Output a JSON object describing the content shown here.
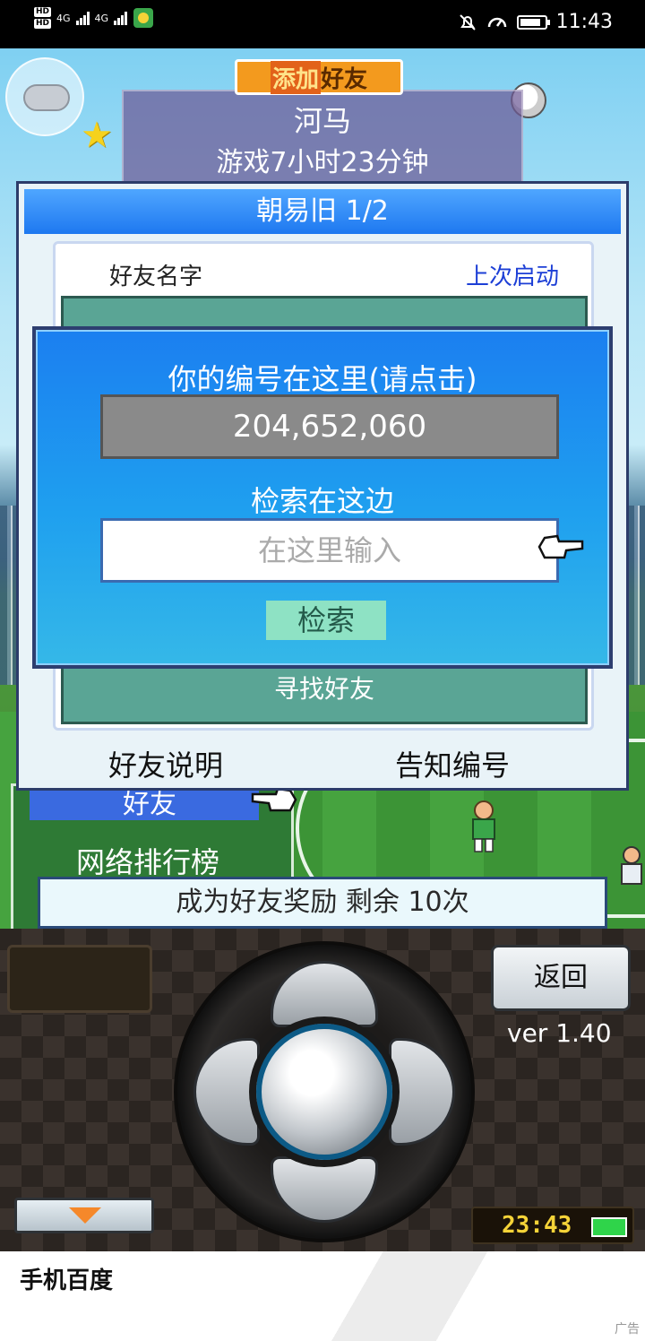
{
  "status_bar": {
    "hd1": "HD",
    "hd2": "HD",
    "net1": "4G",
    "net2": "4G",
    "time": "11:43"
  },
  "game": {
    "add_friend_badge": {
      "part1": "添加",
      "part2": "好友"
    },
    "profile": {
      "name": "河马",
      "play_time": "游戏7小时23分钟"
    },
    "friend_panel": {
      "title": "朝易旧 1/2",
      "col_name": "好友名字",
      "col_last_launch": "上次启动",
      "find_friend": "寻找好友",
      "explain_button": "好友说明",
      "notify_id_button": "告知编号"
    },
    "search_dialog": {
      "id_prompt": "你的编号在这里(请点击)",
      "id_value": "204,652,060",
      "search_label": "检索在这边",
      "input_placeholder": "在这里输入",
      "search_button": "检索"
    },
    "left_menu": {
      "friends": "好友",
      "ranking": "网络排行榜"
    },
    "bonus_bar": "成为好友奖励 剩余 10次"
  },
  "controller": {
    "back_button": "返回",
    "version": "ver 1.40",
    "clock": "23:43"
  },
  "ad": {
    "title": "手机百度",
    "tag": "广告"
  },
  "colors": {
    "panel_title": "#1e78f0",
    "dialog": "#1b7ff0",
    "accent_orange": "#f39a1e",
    "clock": "#f5d338"
  }
}
